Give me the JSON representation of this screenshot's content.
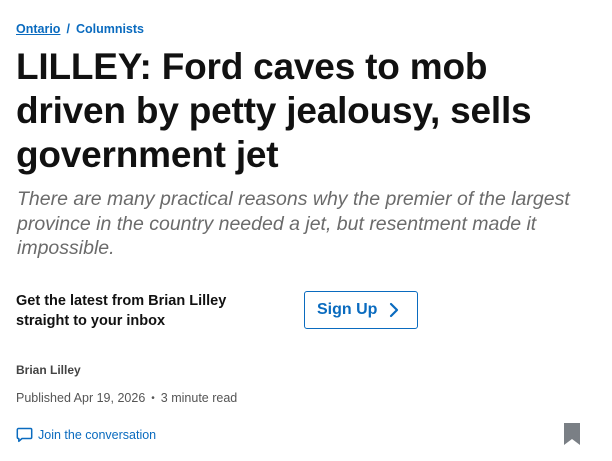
{
  "breadcrumb": {
    "items": [
      "Ontario",
      "Columnists"
    ],
    "separator": "/"
  },
  "article": {
    "headline": "LILLEY: Ford caves to mob driven by petty jealousy, sells government jet",
    "deck": "There are many practical reasons why the premier of the largest province in the country needed a jet, but resentment made it impossible."
  },
  "newsletter": {
    "prompt_line1": "Get the latest from Brian Lilley",
    "prompt_line2": "straight to your inbox",
    "button_label": "Sign Up"
  },
  "byline": {
    "author": "Brian Lilley",
    "published": "Published Apr 19, 2026",
    "separator": "•",
    "read_time": "3 minute read"
  },
  "actions": {
    "join_label": "Join the conversation"
  },
  "icons": {
    "signup_chevron": "chevron-right-icon",
    "comment": "comment-bubble-icon",
    "bookmark": "bookmark-icon"
  },
  "colors": {
    "link_blue": "#0a6bbf",
    "headline": "#111111",
    "deck_gray": "#6b6b6b",
    "bookmark_gray": "#7a7f85"
  }
}
